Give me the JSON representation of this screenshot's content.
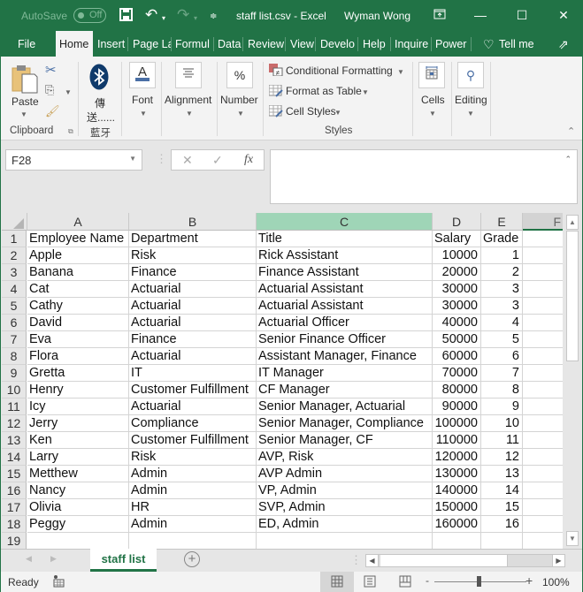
{
  "titlebar": {
    "autosave_label": "AutoSave",
    "autosave_state": "Off",
    "document_title": "staff list.csv  -  Excel",
    "user_name": "Wyman Wong"
  },
  "tabs": [
    {
      "label": "File"
    },
    {
      "label": "Home",
      "active": true
    },
    {
      "label": "Insert"
    },
    {
      "label": "Page La"
    },
    {
      "label": "Formul"
    },
    {
      "label": "Data"
    },
    {
      "label": "Review"
    },
    {
      "label": "View"
    },
    {
      "label": "Develo"
    },
    {
      "label": "Help"
    },
    {
      "label": "Inquire"
    },
    {
      "label": "Power I"
    },
    {
      "label": "Tell me"
    }
  ],
  "ribbon": {
    "clipboard": {
      "paste_label": "Paste",
      "group_label": "Clipboard"
    },
    "bluetooth": {
      "label_line1": "傳",
      "label_line2": "送......",
      "group_label": "藍牙"
    },
    "font_label": "Font",
    "alignment_label": "Alignment",
    "number_label": "Number",
    "styles": {
      "conditional_formatting": "Conditional Formatting",
      "format_as_table": "Format as Table",
      "cell_styles": "Cell Styles",
      "group_label": "Styles"
    },
    "cells_label": "Cells",
    "editing_label": "Editing"
  },
  "formula_bar": {
    "name_box": "F28",
    "formula_value": ""
  },
  "sheet": {
    "columns": [
      {
        "letter": "A"
      },
      {
        "letter": "B"
      },
      {
        "letter": "C",
        "selected": true
      },
      {
        "letter": "D"
      },
      {
        "letter": "E"
      },
      {
        "letter": "F"
      }
    ],
    "rows": [
      [
        "Employee Name",
        "Department",
        "Title",
        "Salary",
        "Grade"
      ],
      [
        "Apple",
        "Risk",
        "Rick Assistant",
        "10000",
        "1"
      ],
      [
        "Banana",
        "Finance",
        "Finance Assistant",
        "20000",
        "2"
      ],
      [
        "Cat",
        "Actuarial",
        "Actuarial Assistant",
        "30000",
        "3"
      ],
      [
        "Cathy",
        "Actuarial",
        "Actuarial Assistant",
        "30000",
        "3"
      ],
      [
        "David",
        "Actuarial",
        "Actuarial Officer",
        "40000",
        "4"
      ],
      [
        "Eva",
        "Finance",
        "Senior Finance Officer",
        "50000",
        "5"
      ],
      [
        "Flora",
        "Actuarial",
        "Assistant Manager, Finance",
        "60000",
        "6"
      ],
      [
        "Gretta",
        "IT",
        "IT Manager",
        "70000",
        "7"
      ],
      [
        "Henry",
        "Customer Fulfillment",
        "CF Manager",
        "80000",
        "8"
      ],
      [
        "Icy",
        "Actuarial",
        "Senior Manager, Actuarial",
        "90000",
        "9"
      ],
      [
        "Jerry",
        "Compliance",
        "Senior Manager, Compliance",
        "100000",
        "10"
      ],
      [
        "Ken",
        "Customer Fulfillment",
        "Senior Manager, CF",
        "110000",
        "11"
      ],
      [
        "Larry",
        "Risk",
        "AVP, Risk",
        "120000",
        "12"
      ],
      [
        "Metthew",
        "Admin",
        "AVP Admin",
        "130000",
        "13"
      ],
      [
        "Nancy",
        "Admin",
        "VP, Admin",
        "140000",
        "14"
      ],
      [
        "Olivia",
        "HR",
        "SVP, Admin",
        "150000",
        "15"
      ],
      [
        "Peggy",
        "Admin",
        "ED, Admin",
        "160000",
        "16"
      ],
      [
        "",
        "",
        "",
        "",
        ""
      ]
    ],
    "row_numbers": [
      "1",
      "2",
      "3",
      "4",
      "5",
      "6",
      "7",
      "8",
      "9",
      "10",
      "11",
      "12",
      "13",
      "14",
      "15",
      "16",
      "17",
      "18",
      "19"
    ]
  },
  "sheet_tabs": [
    {
      "label": "staff list",
      "active": true
    }
  ],
  "status": {
    "ready": "Ready",
    "zoom": "100%",
    "zoom_minus": "-",
    "zoom_plus": "+"
  }
}
